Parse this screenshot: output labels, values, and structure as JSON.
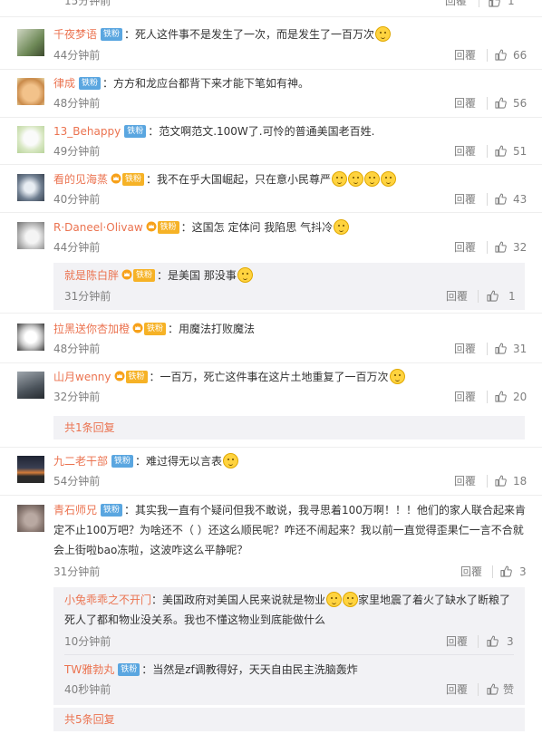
{
  "reply_label": "回覆",
  "more_label": "共1条回复",
  "more_label_2": "共5条回复",
  "comments": [
    {
      "time": "15分钟前",
      "likes": "1"
    },
    {
      "user": "千夜梦语",
      "badge": "铁粉",
      "text": "：死人这件事不是发生了一次，而是发生了一百万次",
      "time": "44分钟前",
      "likes": "66"
    },
    {
      "user": "律成",
      "badge": "铁粉",
      "text": "：方方和龙应台都背下来才能下笔如有神。",
      "time": "48分钟前",
      "likes": "56"
    },
    {
      "user": "13_Behappy",
      "badge": "铁粉",
      "text": "：范文啊范文.100W了.可怜的普通美国老百姓.",
      "time": "49分钟前",
      "likes": "51"
    },
    {
      "user": "看的见海蒸",
      "badge": "铁粉",
      "text": "：我不在乎大国崛起，只在意小民尊严",
      "time": "40分钟前",
      "likes": "43"
    },
    {
      "user": "R·Daneel·Olivaw",
      "badge": "铁粉",
      "text": "：这国怎 定体问 我陷思 气抖冷",
      "time": "44分钟前",
      "likes": "32"
    },
    {
      "user": "拉黑送你杏加橙",
      "badge": "铁粉",
      "text": "：用魔法打败魔法",
      "time": "48分钟前",
      "likes": "31"
    },
    {
      "user": "山月wenny",
      "badge": "铁粉",
      "text": "：一百万，死亡这件事在这片土地重复了一百万次",
      "time": "32分钟前",
      "likes": "20"
    },
    {
      "user": "九二老干部",
      "badge": "铁粉",
      "text": "：难过得无以言表",
      "time": "54分钟前",
      "likes": "18"
    },
    {
      "user": "青石师兄",
      "badge": "铁粉",
      "text": "：其实我一直有个疑问但我不敢说，我寻思着100万啊！！！他们的家人联合起来肯定不止100万吧？为啥还不（ ）还这么顺民呢？咋还不闹起来？我以前一直觉得歪果仁一言不合就会上街啦bao冻啦，这波咋这么平静呢？",
      "time": "31分钟前",
      "likes": "3"
    }
  ],
  "sub_replies": [
    {
      "user": "就是陈白胖",
      "badge": "铁粉",
      "text": "：是美国 那没事",
      "time": "31分钟前",
      "likes": "1"
    },
    {
      "user": "小兔乖乖之不开门",
      "text": "：美国政府对美国人民来说就是物业",
      "text2": "家里地震了着火了缺水了断粮了死人了都和物业没关系。我也不懂这物业到底能做什么",
      "time": "10分钟前",
      "likes": "3"
    },
    {
      "user": "TW雅勃丸",
      "badge": "铁粉",
      "text": "：当然是zf调教得好，天天自由民主洗脑轰炸",
      "time": "40秒钟前",
      "likes": "赞"
    }
  ]
}
